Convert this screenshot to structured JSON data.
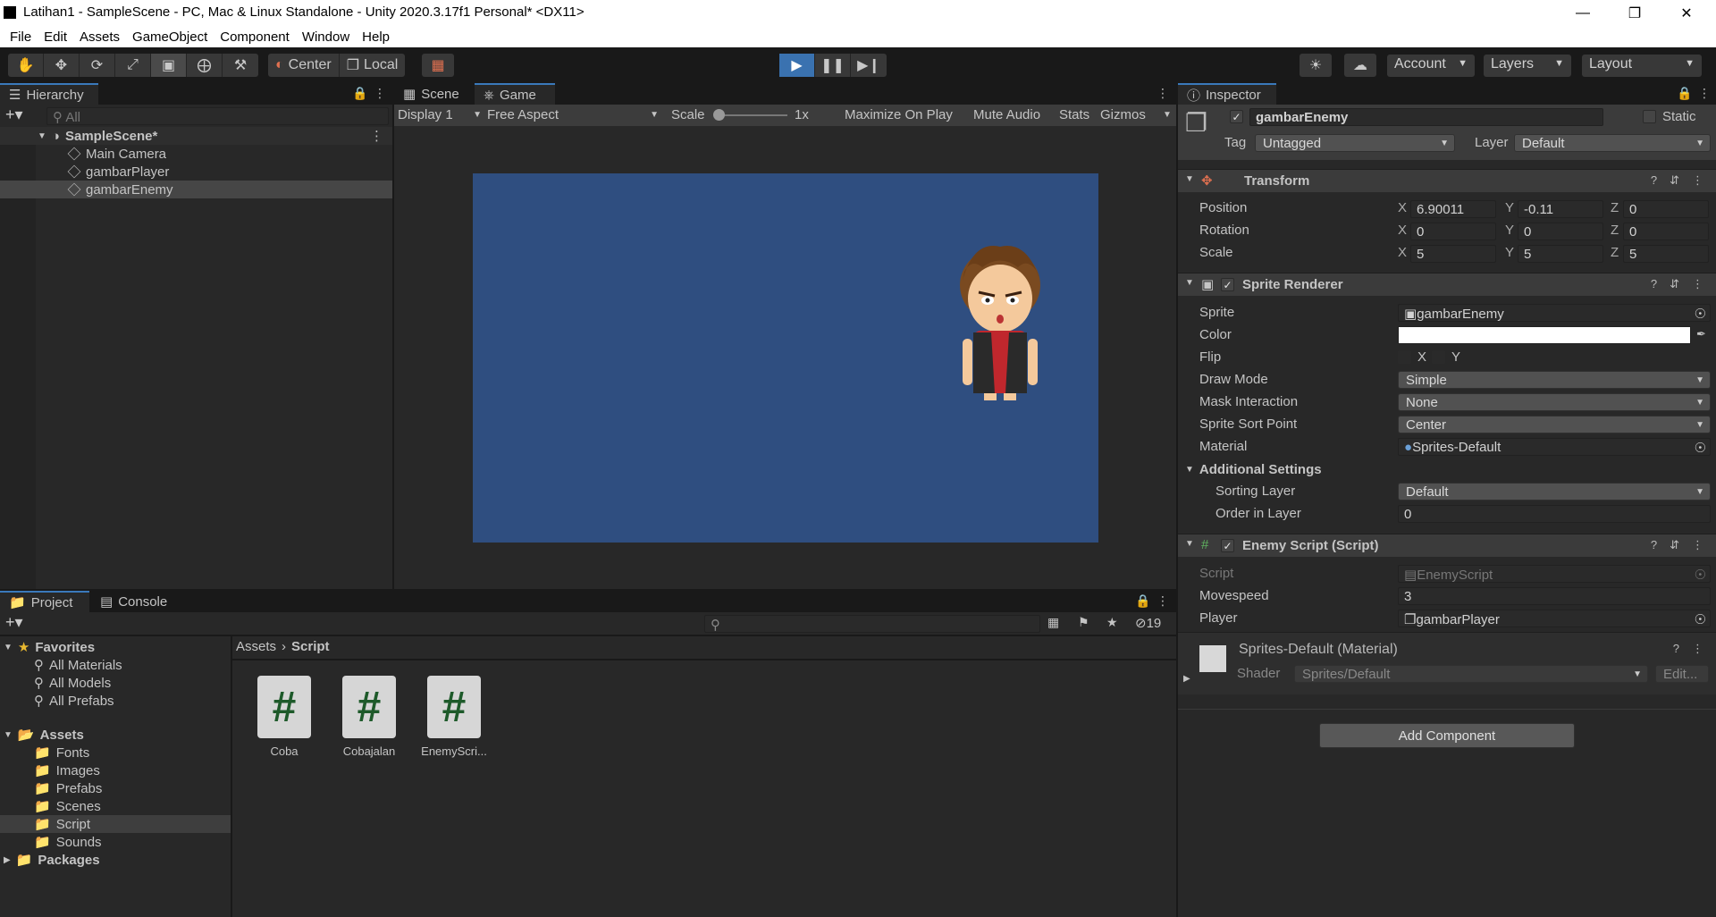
{
  "window": {
    "title": "Latihan1 - SampleScene - PC, Mac & Linux Standalone - Unity 2020.3.17f1 Personal* <DX11>"
  },
  "menu": [
    "File",
    "Edit",
    "Assets",
    "GameObject",
    "Component",
    "Window",
    "Help"
  ],
  "toolbar": {
    "pivot": "Center",
    "space": "Local",
    "account": "Account",
    "layers": "Layers",
    "layout": "Layout"
  },
  "hierarchy": {
    "tab": "Hierarchy",
    "search_placeholder": "All",
    "scene": "SampleScene*",
    "items": [
      "Main Camera",
      "gambarPlayer",
      "gambarEnemy"
    ]
  },
  "game": {
    "tabs": [
      "Scene",
      "Game"
    ],
    "display": "Display 1",
    "aspect": "Free Aspect",
    "scale_label": "Scale",
    "scale_value": "1x",
    "buttons": [
      "Maximize On Play",
      "Mute Audio",
      "Stats",
      "Gizmos"
    ],
    "background_color": "#2f4e80"
  },
  "project": {
    "tabs": [
      "Project",
      "Console"
    ],
    "hidden_count": "19",
    "favorites_label": "Favorites",
    "favorites": [
      "All Materials",
      "All Models",
      "All Prefabs"
    ],
    "assets_label": "Assets",
    "folders": [
      "Fonts",
      "Images",
      "Prefabs",
      "Scenes",
      "Script",
      "Sounds"
    ],
    "packages_label": "Packages",
    "breadcrumb": [
      "Assets",
      "Script"
    ],
    "files": [
      "Coba",
      "Cobajalan",
      "EnemyScri..."
    ]
  },
  "inspector": {
    "tab": "Inspector",
    "object_name": "gambarEnemy",
    "static_label": "Static",
    "tag_label": "Tag",
    "tag_value": "Untagged",
    "layer_label": "Layer",
    "layer_value": "Default",
    "transform": {
      "title": "Transform",
      "rows": [
        {
          "label": "Position",
          "x": "6.90011",
          "y": "-0.11",
          "z": "0"
        },
        {
          "label": "Rotation",
          "x": "0",
          "y": "0",
          "z": "0"
        },
        {
          "label": "Scale",
          "x": "5",
          "y": "5",
          "z": "5"
        }
      ]
    },
    "sprite_renderer": {
      "title": "Sprite Renderer",
      "sprite_label": "Sprite",
      "sprite_value": "gambarEnemy",
      "color_label": "Color",
      "flip_label": "Flip",
      "flip_x": "X",
      "flip_y": "Y",
      "draw_mode_label": "Draw Mode",
      "draw_mode_value": "Simple",
      "mask_label": "Mask Interaction",
      "mask_value": "None",
      "sort_point_label": "Sprite Sort Point",
      "sort_point_value": "Center",
      "material_label": "Material",
      "material_value": "Sprites-Default",
      "additional_label": "Additional Settings",
      "sorting_layer_label": "Sorting Layer",
      "sorting_layer_value": "Default",
      "order_label": "Order in Layer",
      "order_value": "0"
    },
    "enemy_script": {
      "title": "Enemy Script (Script)",
      "script_label": "Script",
      "script_value": "EnemyScript",
      "movespeed_label": "Movespeed",
      "movespeed_value": "3",
      "player_label": "Player",
      "player_value": "gambarPlayer"
    },
    "material": {
      "title": "Sprites-Default (Material)",
      "shader_label": "Shader",
      "shader_value": "Sprites/Default",
      "edit_label": "Edit..."
    },
    "add_component": "Add Component"
  }
}
